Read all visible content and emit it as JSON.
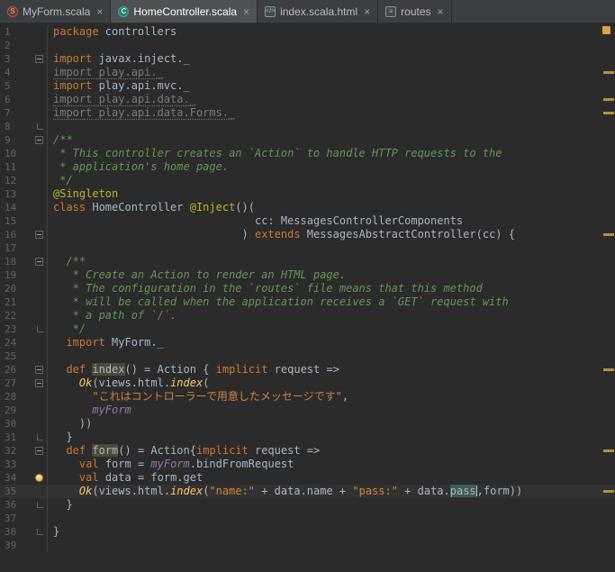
{
  "ui": {
    "close_glyph": "×"
  },
  "tabs": [
    {
      "label": "MyForm.scala",
      "icon_glyph": "S",
      "active": false
    },
    {
      "label": "HomeController.scala",
      "icon_glyph": "C",
      "active": true
    },
    {
      "label": "index.scala.html",
      "icon_glyph": "</>",
      "active": false
    },
    {
      "label": "routes",
      "icon_glyph": "≡",
      "active": false
    }
  ],
  "colors": {
    "background": "#2b2b2b",
    "tab_bar": "#3c3f41",
    "keyword": "#cc7832",
    "string": "#cc8242",
    "comment": "#629755",
    "annotation": "#bbb529",
    "text": "#a9b7c6",
    "warning_stripe": "#b8913c"
  },
  "editor": {
    "current_line": 35,
    "bulb_line": 34,
    "error_stripe_lines": [
      4,
      6,
      7,
      16,
      26,
      32,
      35
    ],
    "lines": [
      {
        "n": 1,
        "fold": "",
        "tokens": [
          [
            "kw",
            "package"
          ],
          [
            "pl",
            " controllers"
          ]
        ]
      },
      {
        "n": 2,
        "fold": "",
        "tokens": []
      },
      {
        "n": 3,
        "fold": "start",
        "tokens": [
          [
            "kw",
            "import"
          ],
          [
            "pl",
            " javax.inject._"
          ]
        ]
      },
      {
        "n": 4,
        "fold": "",
        "tokens": [
          [
            "gray",
            "import play.api._"
          ]
        ]
      },
      {
        "n": 5,
        "fold": "",
        "tokens": [
          [
            "kw",
            "import"
          ],
          [
            "pl",
            " play.api.mvc._"
          ]
        ]
      },
      {
        "n": 6,
        "fold": "",
        "tokens": [
          [
            "gray",
            "import play.api.data._"
          ]
        ]
      },
      {
        "n": 7,
        "fold": "",
        "tokens": [
          [
            "gray",
            "import play.api.data.Forms._"
          ]
        ]
      },
      {
        "n": 8,
        "fold": "end",
        "tokens": []
      },
      {
        "n": 9,
        "fold": "start",
        "tokens": [
          [
            "cm",
            "/**"
          ]
        ]
      },
      {
        "n": 10,
        "fold": "",
        "tokens": [
          [
            "cm",
            " * This controller creates an `Action` to handle HTTP requests to the"
          ]
        ]
      },
      {
        "n": 11,
        "fold": "",
        "tokens": [
          [
            "cm",
            " * application's home page."
          ]
        ]
      },
      {
        "n": 12,
        "fold": "",
        "tokens": [
          [
            "cm",
            " */"
          ]
        ]
      },
      {
        "n": 13,
        "fold": "",
        "tokens": [
          [
            "ann",
            "@Singleton"
          ]
        ]
      },
      {
        "n": 14,
        "fold": "",
        "tokens": [
          [
            "kw",
            "class"
          ],
          [
            "pl",
            " HomeController "
          ],
          [
            "ann",
            "@Inject"
          ],
          [
            "pl",
            "()("
          ]
        ]
      },
      {
        "n": 15,
        "fold": "",
        "tokens": [
          [
            "pl",
            "                               cc: MessagesControllerComponents"
          ]
        ]
      },
      {
        "n": 16,
        "fold": "start",
        "tokens": [
          [
            "pl",
            "                             ) "
          ],
          [
            "kw",
            "extends"
          ],
          [
            "pl",
            " MessagesAbstractController(cc) {"
          ]
        ]
      },
      {
        "n": 17,
        "fold": "",
        "tokens": []
      },
      {
        "n": 18,
        "fold": "start",
        "tokens": [
          [
            "pl",
            "  "
          ],
          [
            "cm",
            "/**"
          ]
        ]
      },
      {
        "n": 19,
        "fold": "",
        "tokens": [
          [
            "cm",
            "   * Create an Action to render an HTML page."
          ]
        ]
      },
      {
        "n": 20,
        "fold": "",
        "tokens": [
          [
            "cm",
            "   * The configuration in the `routes` file means that this method"
          ]
        ]
      },
      {
        "n": 21,
        "fold": "",
        "tokens": [
          [
            "cm",
            "   * will be called when the application receives a `GET` request with"
          ]
        ]
      },
      {
        "n": 22,
        "fold": "",
        "tokens": [
          [
            "cm",
            "   * a path of `/`."
          ]
        ]
      },
      {
        "n": 23,
        "fold": "end",
        "tokens": [
          [
            "cm",
            "   */"
          ]
        ]
      },
      {
        "n": 24,
        "fold": "",
        "tokens": [
          [
            "pl",
            "  "
          ],
          [
            "kw",
            "import"
          ],
          [
            "pl",
            " MyForm._"
          ]
        ]
      },
      {
        "n": 25,
        "fold": "",
        "tokens": []
      },
      {
        "n": 26,
        "fold": "start",
        "tokens": [
          [
            "pl",
            "  "
          ],
          [
            "kw",
            "def"
          ],
          [
            "pl",
            " "
          ],
          [
            "hl",
            "index"
          ],
          [
            "pl",
            "() = Action { "
          ],
          [
            "kw",
            "implicit"
          ],
          [
            "pl",
            " request =>"
          ]
        ]
      },
      {
        "n": 27,
        "fold": "start",
        "tokens": [
          [
            "pl",
            "    "
          ],
          [
            "fn",
            "Ok"
          ],
          [
            "pl",
            "(views.html."
          ],
          [
            "fn",
            "index"
          ],
          [
            "pl",
            "("
          ]
        ]
      },
      {
        "n": 28,
        "fold": "",
        "tokens": [
          [
            "pl",
            "      "
          ],
          [
            "str",
            "\"これはコントローラーで用意したメッセージです\""
          ],
          [
            "pl",
            ","
          ]
        ]
      },
      {
        "n": 29,
        "fold": "",
        "tokens": [
          [
            "pl",
            "      "
          ],
          [
            "fld",
            "myForm"
          ]
        ]
      },
      {
        "n": 30,
        "fold": "",
        "tokens": [
          [
            "pl",
            "    ))"
          ]
        ]
      },
      {
        "n": 31,
        "fold": "end",
        "tokens": [
          [
            "pl",
            "  }"
          ]
        ]
      },
      {
        "n": 32,
        "fold": "start",
        "tokens": [
          [
            "pl",
            "  "
          ],
          [
            "kw",
            "def"
          ],
          [
            "pl",
            " "
          ],
          [
            "hl",
            "form"
          ],
          [
            "pl",
            "() = Action{"
          ],
          [
            "kw",
            "implicit"
          ],
          [
            "pl",
            " request =>"
          ]
        ]
      },
      {
        "n": 33,
        "fold": "",
        "tokens": [
          [
            "pl",
            "    "
          ],
          [
            "kw",
            "val"
          ],
          [
            "pl",
            " form = "
          ],
          [
            "fld",
            "myForm"
          ],
          [
            "pl",
            ".bindFromRequest"
          ]
        ]
      },
      {
        "n": 34,
        "fold": "",
        "bulb": true,
        "tokens": [
          [
            "pl",
            "    "
          ],
          [
            "kw",
            "val"
          ],
          [
            "pl",
            " data = form.get"
          ]
        ]
      },
      {
        "n": 35,
        "fold": "",
        "cur": true,
        "tokens": [
          [
            "pl",
            "    "
          ],
          [
            "fn",
            "Ok"
          ],
          [
            "pl",
            "(views.html."
          ],
          [
            "fn",
            "index"
          ],
          [
            "pl",
            "("
          ],
          [
            "str",
            "\"name:\""
          ],
          [
            "pl",
            " + data.name + "
          ],
          [
            "str",
            "\"pass:\""
          ],
          [
            "pl",
            " + data."
          ],
          [
            "hl2",
            "pass"
          ],
          [
            "caret",
            ""
          ],
          [
            "pl",
            ",form))"
          ]
        ]
      },
      {
        "n": 36,
        "fold": "end",
        "tokens": [
          [
            "pl",
            "  }"
          ]
        ]
      },
      {
        "n": 37,
        "fold": "",
        "tokens": []
      },
      {
        "n": 38,
        "fold": "end",
        "tokens": [
          [
            "pl",
            "}"
          ]
        ]
      },
      {
        "n": 39,
        "fold": "",
        "tokens": []
      }
    ]
  }
}
